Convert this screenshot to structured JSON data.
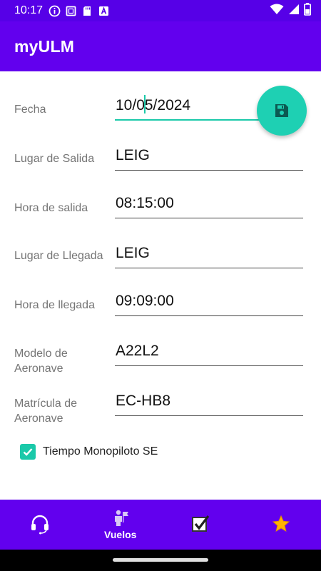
{
  "status_bar": {
    "time": "10:17",
    "left_icons": [
      "info-icon",
      "square-icon",
      "sd-card-icon",
      "a-icon"
    ],
    "right_icons": [
      "wifi-icon",
      "signal-icon",
      "battery-icon"
    ]
  },
  "app_bar": {
    "title": "myULM"
  },
  "fab": {
    "icon": "save-icon",
    "color": "#1ed0b3"
  },
  "form": {
    "fecha": {
      "label": "Fecha",
      "value_before_cursor": "10/0",
      "value_after_cursor": "5/2024"
    },
    "lugar_salida": {
      "label": "Lugar de Salida",
      "value": "LEIG"
    },
    "hora_salida": {
      "label": "Hora de salida",
      "value": "08:15:00"
    },
    "lugar_llegada": {
      "label": "Lugar de Llegada",
      "value": "LEIG"
    },
    "hora_llegada": {
      "label": "Hora de llegada",
      "value": "09:09:00"
    },
    "modelo": {
      "label": "Modelo de Aeronave",
      "value": "A22L2"
    },
    "matricula": {
      "label": "Matrícula de Aeronave",
      "value": "EC-HB8"
    }
  },
  "checkbox": {
    "label": "Tiempo Monopiloto SE",
    "checked": true
  },
  "bottom_nav": {
    "items": [
      {
        "icon": "headset-icon",
        "label": ""
      },
      {
        "icon": "pilot-flag-icon",
        "label": "Vuelos"
      },
      {
        "icon": "checklist-icon",
        "label": ""
      },
      {
        "icon": "star-icon",
        "label": ""
      }
    ]
  },
  "colors": {
    "primary": "#6200ee",
    "status_bar": "#5600e7",
    "accent": "#1ac9a9",
    "star": "#ffb300"
  }
}
